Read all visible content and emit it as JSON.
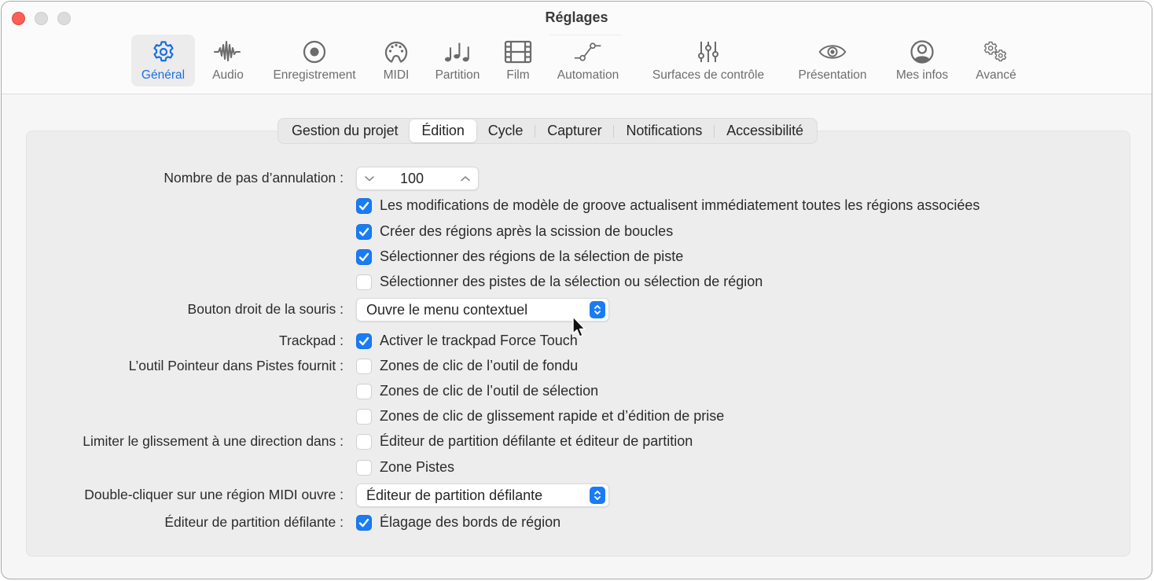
{
  "window": {
    "title": "Réglages",
    "controls": {
      "close": "close",
      "minimize": "minimize",
      "zoom": "zoom"
    }
  },
  "toolbar": {
    "items": [
      {
        "label": "Général",
        "icon": "gear-icon",
        "active": true
      },
      {
        "label": "Audio",
        "icon": "waveform-icon",
        "active": false
      },
      {
        "label": "Enregistrement",
        "icon": "record-icon",
        "active": false
      },
      {
        "label": "MIDI",
        "icon": "midi-port-icon",
        "active": false
      },
      {
        "label": "Partition",
        "icon": "music-notes-icon",
        "active": false
      },
      {
        "label": "Film",
        "icon": "film-icon",
        "active": false
      },
      {
        "label": "Automation",
        "icon": "automation-curve-icon",
        "active": false
      },
      {
        "label": "Surfaces de contrôle",
        "icon": "sliders-icon",
        "active": false
      },
      {
        "label": "Présentation",
        "icon": "eye-icon",
        "active": false
      },
      {
        "label": "Mes infos",
        "icon": "person-circle-icon",
        "active": false
      },
      {
        "label": "Avancé",
        "icon": "gears-icon",
        "active": false
      }
    ]
  },
  "tabs": {
    "items": [
      {
        "label": "Gestion du projet",
        "active": false
      },
      {
        "label": "Édition",
        "active": true
      },
      {
        "label": "Cycle",
        "active": false
      },
      {
        "label": "Capturer",
        "active": false
      },
      {
        "label": "Notifications",
        "active": false
      },
      {
        "label": "Accessibilité",
        "active": false
      }
    ]
  },
  "settings": {
    "undo_steps": {
      "label": "Nombre de pas d’annulation :",
      "value": "100"
    },
    "groove_checks": [
      {
        "label": "Les modifications de modèle de groove actualisent immédiatement toutes les régions associées",
        "checked": true
      },
      {
        "label": "Créer des régions après la scission de boucles",
        "checked": true
      },
      {
        "label": "Sélectionner des régions de la sélection de piste",
        "checked": true
      },
      {
        "label": "Sélectionner des pistes de la sélection ou sélection de région",
        "checked": false
      }
    ],
    "right_click": {
      "label": "Bouton droit de la souris :",
      "value": "Ouvre le menu contextuel"
    },
    "trackpad": {
      "label": "Trackpad :",
      "option": "Activer le trackpad Force Touch",
      "checked": true
    },
    "pointer_tool": {
      "label": "L’outil Pointeur dans Pistes fournit :",
      "options": [
        {
          "label": "Zones de clic de l’outil de fondu",
          "checked": false
        },
        {
          "label": "Zones de clic de l’outil de sélection",
          "checked": false
        },
        {
          "label": "Zones de clic de glissement rapide et d’édition de prise",
          "checked": false
        }
      ]
    },
    "limit_drag": {
      "label": "Limiter le glissement à une direction dans :",
      "options": [
        {
          "label": "Éditeur de partition défilante et éditeur de partition",
          "checked": false
        },
        {
          "label": "Zone Pistes",
          "checked": false
        }
      ]
    },
    "double_click_midi": {
      "label": "Double-cliquer sur une région MIDI ouvre :",
      "value": "Éditeur de partition défilante"
    },
    "piano_roll": {
      "label": "Éditeur de partition défilante :",
      "option": "Élagage des bords de région",
      "checked": true
    }
  },
  "colors": {
    "accent": "#1a7cf5",
    "close_button": "#fe5f57"
  }
}
